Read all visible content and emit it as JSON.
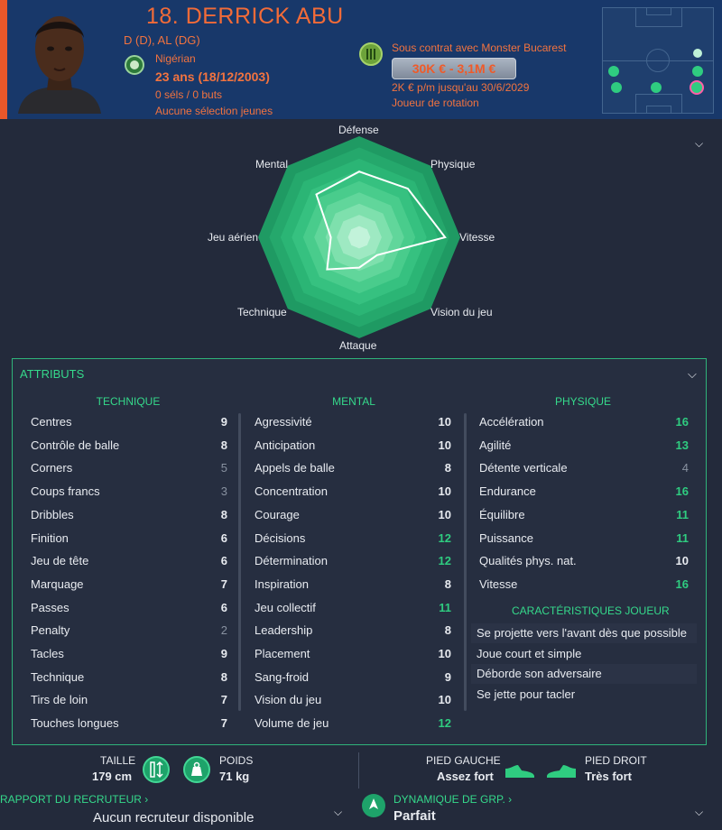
{
  "player": {
    "name": "18. DERRICK ABU",
    "positions": "D (D), AL (DG)",
    "nationality": "Nigérian",
    "age": "23 ans (18/12/2003)",
    "caps": "0 séls / 0 buts",
    "youth_caps": "Aucune sélection jeunes"
  },
  "contract": {
    "club": "Sous contrat avec Monster Bucarest",
    "value": "30K € - 3,1M €",
    "wage": "2K € p/m jusqu'au 30/6/2029",
    "role": "Joueur de rotation"
  },
  "radar": {
    "labels": {
      "defense": "Défense",
      "physique": "Physique",
      "vitesse": "Vitesse",
      "vision": "Vision du jeu",
      "attaque": "Attaque",
      "technique": "Technique",
      "aerien": "Jeu aérien",
      "mental": "Mental"
    },
    "player_levels": [
      0.65,
      0.68,
      0.85,
      0.25,
      0.3,
      0.45,
      0.28,
      0.6
    ]
  },
  "attributes": {
    "title": "ATTRIBUTS",
    "technique": {
      "header": "TECHNIQUE",
      "rows": [
        {
          "label": "Centres",
          "value": "9"
        },
        {
          "label": "Contrôle de balle",
          "value": "8"
        },
        {
          "label": "Corners",
          "value": "5"
        },
        {
          "label": "Coups francs",
          "value": "3"
        },
        {
          "label": "Dribbles",
          "value": "8"
        },
        {
          "label": "Finition",
          "value": "6"
        },
        {
          "label": "Jeu de tête",
          "value": "6"
        },
        {
          "label": "Marquage",
          "value": "7"
        },
        {
          "label": "Passes",
          "value": "6"
        },
        {
          "label": "Penalty",
          "value": "2"
        },
        {
          "label": "Tacles",
          "value": "9"
        },
        {
          "label": "Technique",
          "value": "8"
        },
        {
          "label": "Tirs de loin",
          "value": "7"
        },
        {
          "label": "Touches longues",
          "value": "7"
        }
      ]
    },
    "mental": {
      "header": "MENTAL",
      "rows": [
        {
          "label": "Agressivité",
          "value": "10"
        },
        {
          "label": "Anticipation",
          "value": "10"
        },
        {
          "label": "Appels de balle",
          "value": "8"
        },
        {
          "label": "Concentration",
          "value": "10"
        },
        {
          "label": "Courage",
          "value": "10"
        },
        {
          "label": "Décisions",
          "value": "12"
        },
        {
          "label": "Détermination",
          "value": "12"
        },
        {
          "label": "Inspiration",
          "value": "8"
        },
        {
          "label": "Jeu collectif",
          "value": "11"
        },
        {
          "label": "Leadership",
          "value": "8"
        },
        {
          "label": "Placement",
          "value": "10"
        },
        {
          "label": "Sang-froid",
          "value": "9"
        },
        {
          "label": "Vision du jeu",
          "value": "10"
        },
        {
          "label": "Volume de jeu",
          "value": "12"
        }
      ]
    },
    "physique": {
      "header": "PHYSIQUE",
      "rows": [
        {
          "label": "Accélération",
          "value": "16"
        },
        {
          "label": "Agilité",
          "value": "13"
        },
        {
          "label": "Détente verticale",
          "value": "4"
        },
        {
          "label": "Endurance",
          "value": "16"
        },
        {
          "label": "Équilibre",
          "value": "11"
        },
        {
          "label": "Puissance",
          "value": "11"
        },
        {
          "label": "Qualités phys. nat.",
          "value": "10"
        },
        {
          "label": "Vitesse",
          "value": "16"
        }
      ]
    },
    "traits": {
      "header": "CARACTÉRISTIQUES JOUEUR",
      "items": [
        "Se projette vers l'avant dès que possible",
        "Joue court et simple",
        "Déborde son adversaire",
        "Se jette pour tacler"
      ]
    }
  },
  "physical": {
    "height_label": "TAILLE",
    "height": "179 cm",
    "weight_label": "POIDS",
    "weight": "71 kg",
    "left_foot_label": "PIED GAUCHE",
    "left_foot": "Assez fort",
    "right_foot_label": "PIED DROIT",
    "right_foot": "Très fort"
  },
  "scout": {
    "title": "RAPPORT DU RECRUTEUR",
    "value": "Aucun recruteur disponible"
  },
  "dynamics": {
    "title": "DYNAMIQUE DE GRP.",
    "value": "Parfait"
  },
  "colors": {
    "header_bg": "#18386a",
    "accent_orange": "#f26b38",
    "accent_green": "#2fcc80",
    "page_bg": "#232a3b"
  }
}
